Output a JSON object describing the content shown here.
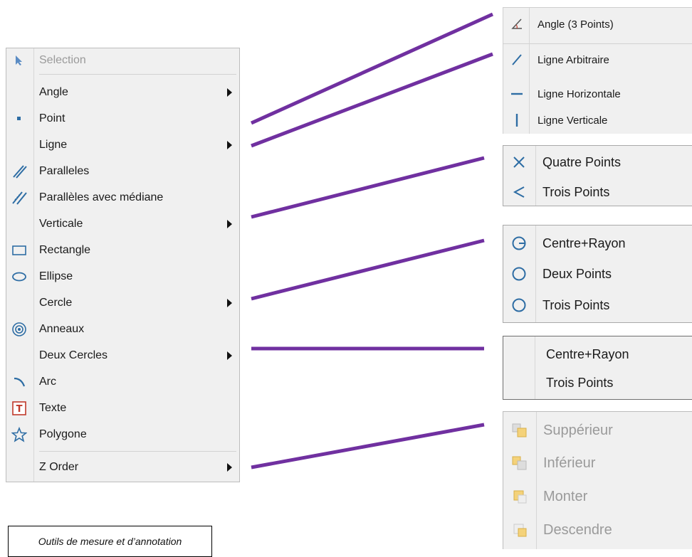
{
  "main_menu": {
    "items": [
      {
        "label": "Selection",
        "icon": "cursor-arrow-icon",
        "disabled": true
      },
      {
        "label": "Angle",
        "submenu": true
      },
      {
        "label": "Point",
        "icon": "point-icon"
      },
      {
        "label": "Ligne",
        "submenu": true
      },
      {
        "label": "Paralleles",
        "icon": "parallel-lines-icon"
      },
      {
        "label": "Parallèles avec médiane",
        "icon": "parallel-median-icon"
      },
      {
        "label": "Verticale",
        "submenu": true
      },
      {
        "label": "Rectangle",
        "icon": "rectangle-icon"
      },
      {
        "label": "Ellipse",
        "icon": "ellipse-icon"
      },
      {
        "label": "Cercle",
        "submenu": true
      },
      {
        "label": "Anneaux",
        "icon": "rings-icon"
      },
      {
        "label": "Deux Cercles",
        "submenu": true
      },
      {
        "label": "Arc",
        "icon": "arc-icon"
      },
      {
        "label": "Texte",
        "icon": "text-icon"
      },
      {
        "label": "Polygone",
        "icon": "polygon-star-icon"
      },
      {
        "label": "Z Order",
        "submenu": true
      }
    ]
  },
  "submenus": {
    "angle": {
      "items": [
        {
          "label": "Angle (3 Points)",
          "icon": "angle-icon"
        }
      ]
    },
    "ligne": {
      "items": [
        {
          "label": "Ligne Arbitraire",
          "icon": "diagonal-line-icon"
        },
        {
          "label": "Ligne Horizontale",
          "icon": "horizontal-line-icon"
        },
        {
          "label": "Ligne Verticale",
          "icon": "vertical-line-icon"
        }
      ]
    },
    "verticale": {
      "items": [
        {
          "label": "Quatre Points",
          "icon": "cross-x-icon"
        },
        {
          "label": "Trois Points",
          "icon": "chevron-left-icon"
        }
      ]
    },
    "cercle": {
      "items": [
        {
          "label": "Centre+Rayon",
          "icon": "circle-radius-icon"
        },
        {
          "label": "Deux Points",
          "icon": "circle-two-points-icon"
        },
        {
          "label": "Trois Points",
          "icon": "circle-three-points-icon"
        }
      ]
    },
    "deux_cercles": {
      "items": [
        {
          "label": "Centre+Rayon"
        },
        {
          "label": "Trois Points"
        }
      ]
    },
    "z_order": {
      "items": [
        {
          "label": "Suppérieur",
          "icon": "bring-to-front-icon",
          "disabled": true
        },
        {
          "label": "Inférieur",
          "icon": "send-to-back-icon",
          "disabled": true
        },
        {
          "label": "Monter",
          "icon": "bring-forward-icon",
          "disabled": true
        },
        {
          "label": "Descendre",
          "icon": "send-backward-icon",
          "disabled": true
        }
      ]
    }
  },
  "caption": "Outils de mesure et d’annotation",
  "colors": {
    "connector": "#7030a0",
    "icon_blue": "#2e6da4",
    "menu_bg": "#f0f0f0",
    "disabled_text": "#9a9a9a"
  }
}
